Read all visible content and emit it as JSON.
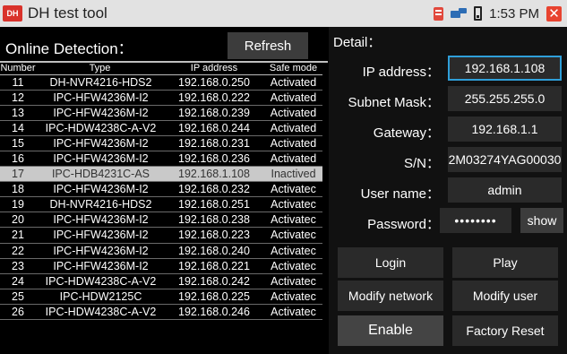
{
  "app": {
    "icon_text": "DH",
    "title": "DH test tool",
    "clock": "1:53 PM",
    "close_glyph": "✕"
  },
  "colors": {
    "title_bar_bg": "#e2e2e2",
    "focus_border": "#2f9fd9",
    "selected_row_bg": "#c9c9c9",
    "close_red": "#e8432f"
  },
  "status_icons": [
    "document-icon",
    "network-icon",
    "battery-icon",
    "close-icon"
  ],
  "left": {
    "section_label": "Online Detection：",
    "refresh_label": "Refresh",
    "columns": [
      "Number",
      "Type",
      "IP address",
      "Safe mode"
    ],
    "selected_row": 6,
    "rows": [
      {
        "num": "11",
        "type": "DH-NVR4216-HDS2",
        "ip": "192.168.0.250",
        "mode": "Activated"
      },
      {
        "num": "12",
        "type": "IPC-HFW4236M-I2",
        "ip": "192.168.0.222",
        "mode": "Activated"
      },
      {
        "num": "13",
        "type": "IPC-HFW4236M-I2",
        "ip": "192.168.0.239",
        "mode": "Activated"
      },
      {
        "num": "14",
        "type": "IPC-HDW4238C-A-V2",
        "ip": "192.168.0.244",
        "mode": "Activated"
      },
      {
        "num": "15",
        "type": "IPC-HFW4236M-I2",
        "ip": "192.168.0.231",
        "mode": "Activated"
      },
      {
        "num": "16",
        "type": "IPC-HFW4236M-I2",
        "ip": "192.168.0.236",
        "mode": "Activated"
      },
      {
        "num": "17",
        "type": "IPC-HDB4231C-AS",
        "ip": "192.168.1.108",
        "mode": "Inactived"
      },
      {
        "num": "18",
        "type": "IPC-HFW4236M-I2",
        "ip": "192.168.0.232",
        "mode": "Activatec"
      },
      {
        "num": "19",
        "type": "DH-NVR4216-HDS2",
        "ip": "192.168.0.251",
        "mode": "Activatec"
      },
      {
        "num": "20",
        "type": "IPC-HFW4236M-I2",
        "ip": "192.168.0.238",
        "mode": "Activatec"
      },
      {
        "num": "21",
        "type": "IPC-HFW4236M-I2",
        "ip": "192.168.0.223",
        "mode": "Activatec"
      },
      {
        "num": "22",
        "type": "IPC-HFW4236M-I2",
        "ip": "192.168.0.240",
        "mode": "Activatec"
      },
      {
        "num": "23",
        "type": "IPC-HFW4236M-I2",
        "ip": "192.168.0.221",
        "mode": "Activatec"
      },
      {
        "num": "24",
        "type": "IPC-HDW4238C-A-V2",
        "ip": "192.168.0.242",
        "mode": "Activatec"
      },
      {
        "num": "25",
        "type": "IPC-HDW2125C",
        "ip": "192.168.0.225",
        "mode": "Activatec"
      },
      {
        "num": "26",
        "type": "IPC-HDW4238C-A-V2",
        "ip": "192.168.0.246",
        "mode": "Activatec"
      }
    ]
  },
  "detail": {
    "section_label": "Detail：",
    "ip_label": "IP address：",
    "ip_value": "192.168.1.108",
    "mask_label": "Subnet Mask：",
    "mask_value": "255.255.255.0",
    "gateway_label": "Gateway：",
    "gateway_value": "192.168.1.1",
    "sn_label": "S/N：",
    "sn_value": "2M03274YAG00030",
    "user_label": "User name：",
    "user_value": "admin",
    "pwd_label": "Password：",
    "pwd_value": "••••••••",
    "show_label": "show"
  },
  "actions": {
    "login": "Login",
    "play": "Play",
    "modify_network": "Modify network",
    "modify_user": "Modify user",
    "enable": "Enable",
    "factory_reset": "Factory Reset"
  }
}
